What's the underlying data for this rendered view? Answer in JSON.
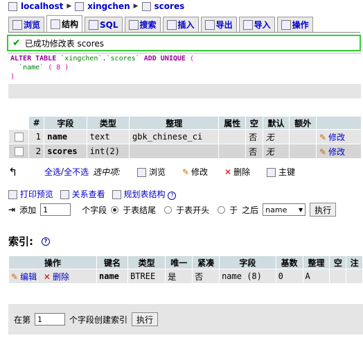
{
  "breadcrumb": {
    "server": "localhost",
    "database": "xingchen",
    "table": "scores"
  },
  "tabs": [
    {
      "label": "浏览",
      "icon": "browse-icon",
      "active": false
    },
    {
      "label": "结构",
      "icon": "structure-icon",
      "active": true
    },
    {
      "label": "SQL",
      "icon": "sql-icon",
      "active": false
    },
    {
      "label": "搜索",
      "icon": "search-icon",
      "active": false
    },
    {
      "label": "插入",
      "icon": "insert-icon",
      "active": false
    },
    {
      "label": "导出",
      "icon": "export-icon",
      "active": false
    },
    {
      "label": "导入",
      "icon": "import-icon",
      "active": false
    },
    {
      "label": "操作",
      "icon": "operations-icon",
      "active": false
    }
  ],
  "notice": {
    "text": "已成功修改表 scores"
  },
  "sql": {
    "alter": "ALTER TABLE",
    "db": "`xingchen`",
    "dot": ".",
    "tbl": "`scores`",
    "add": "ADD UNIQUE",
    "open": "(",
    "col": "`name`",
    "len": "( 8 )",
    "close": ")"
  },
  "columns": {
    "headers": [
      "#",
      "字段",
      "类型",
      "整理",
      "属性",
      "空",
      "默认",
      "额外"
    ],
    "rows": [
      {
        "num": "1",
        "field": "name",
        "type": "text",
        "collation": "gbk_chinese_ci",
        "attr": "",
        "null": "否",
        "default": "无",
        "extra": "",
        "action": "修改"
      },
      {
        "num": "2",
        "field": "scores",
        "type": "int(2)",
        "collation": "",
        "attr": "",
        "null": "否",
        "default": "无",
        "extra": "",
        "action": "修改"
      }
    ]
  },
  "tools": {
    "check_all": "全选",
    "sep": " / ",
    "uncheck_all": "全不选",
    "with_selected": "选中项:",
    "browse": "浏览",
    "edit": "修改",
    "delete": "删除",
    "primary": "主键"
  },
  "options": {
    "print": "打印预览",
    "relations": "关系查看",
    "plan": "规划表结构"
  },
  "add_field": {
    "label": "添加",
    "count": "1",
    "fields_text": "个字段",
    "at_end": "于表结尾",
    "at_start": "于表开头",
    "after": "于",
    "after_suffix": "之后",
    "select_value": "name",
    "go": "执行"
  },
  "indexes": {
    "title": "索引:",
    "headers": [
      "操作",
      "键名",
      "类型",
      "唯一",
      "紧凑",
      "字段",
      "基数",
      "整理",
      "空",
      "注"
    ],
    "rows": [
      {
        "edit": "编辑",
        "delete": "删除",
        "key": "name",
        "type": "BTREE",
        "unique": "是",
        "packed": "否",
        "field": "name (8)",
        "cardinality": "0",
        "collation": "A",
        "null": "",
        "comment": ""
      }
    ]
  },
  "create_index": {
    "prefix": "在第",
    "count": "1",
    "suffix": "个字段创建索引",
    "go": "执行"
  }
}
